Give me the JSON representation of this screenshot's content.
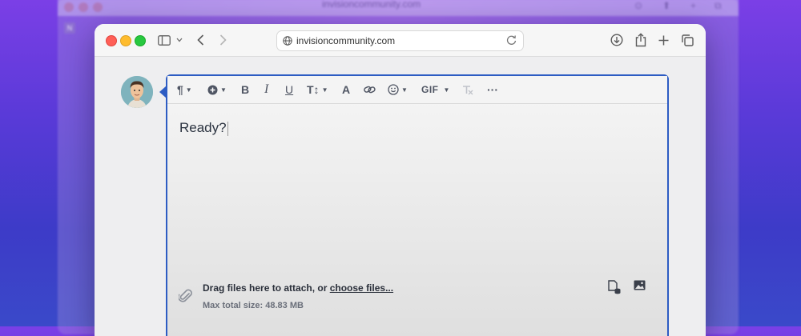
{
  "background_window": {
    "url": "invisioncommunity.com"
  },
  "browser": {
    "url": "invisioncommunity.com"
  },
  "editor": {
    "toolbar": [
      {
        "name": "paragraph-format",
        "icon": "pilcrow-icon",
        "label": "¶"
      },
      {
        "name": "insert",
        "icon": "plus-circle-icon",
        "label": ""
      },
      {
        "name": "bold",
        "icon": "bold-icon",
        "label": "B"
      },
      {
        "name": "italic",
        "icon": "italic-icon",
        "label": "I"
      },
      {
        "name": "underline",
        "icon": "underline-icon",
        "label": "U"
      },
      {
        "name": "font-size",
        "icon": "text-size-icon",
        "label": "T↕"
      },
      {
        "name": "font-color",
        "icon": "font-color-icon",
        "label": "A"
      },
      {
        "name": "link",
        "icon": "link-icon",
        "label": ""
      },
      {
        "name": "emoji",
        "icon": "smiley-icon",
        "label": "☺"
      },
      {
        "name": "gif",
        "icon": "gif-icon",
        "label": "GIF"
      },
      {
        "name": "clear-format",
        "icon": "clear-format-icon",
        "label": "T̸"
      },
      {
        "name": "more",
        "icon": "more-icon",
        "label": "···"
      }
    ],
    "content": "Ready?",
    "attach_text": "Drag files here to attach, or ",
    "attach_link": "choose files...",
    "max_size": "Max total size: 48.83 MB"
  },
  "colors": {
    "editor_border": "#2d5cc3",
    "background_top": "#7b3fe6",
    "background_bottom": "#3a49c9"
  }
}
